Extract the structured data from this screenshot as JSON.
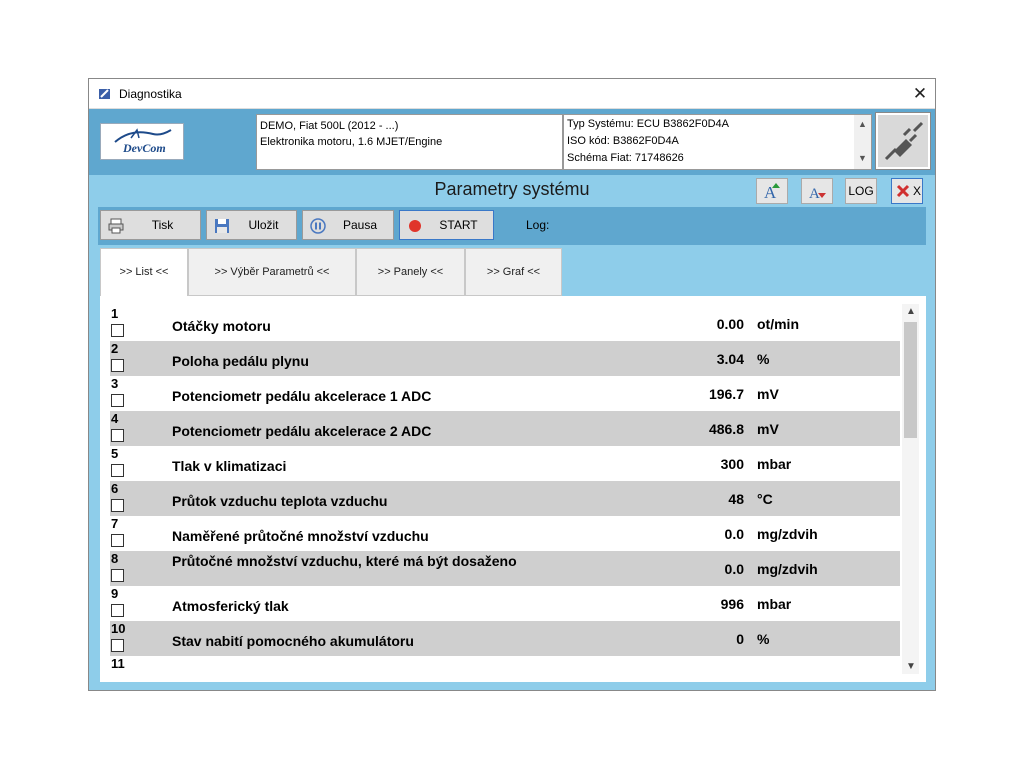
{
  "window": {
    "title": "Diagnostika",
    "close": "✕"
  },
  "logo": {
    "text": "DevCom"
  },
  "vehicle_info": {
    "line1": "DEMO, Fiat 500L (2012 - ...)",
    "line2": "Elektronika motoru, 1.6 MJET/Engine"
  },
  "system_info": {
    "line1": "Typ Systému: ECU B3862F0D4A",
    "line2": "ISO kód: B3862F0D4A",
    "line3": "Schéma Fiat: 71748626"
  },
  "heading": "Parametry systému",
  "top_buttons": {
    "log": "LOG",
    "close_x": "X"
  },
  "toolbar": {
    "print": "Tisk",
    "save": "Uložit",
    "pause": "Pausa",
    "start": "START",
    "log_label": "Log:"
  },
  "tabs": [
    ">> List <<",
    ">> Výběr Parametrů <<",
    ">> Panely <<",
    ">> Graf <<"
  ],
  "rows": [
    {
      "num": "1",
      "name": "Otáčky motoru",
      "value": "0.00",
      "unit": "ot/min"
    },
    {
      "num": "2",
      "name": "Poloha pedálu plynu",
      "value": "3.04",
      "unit": "%"
    },
    {
      "num": "3",
      "name": "Potenciometr pedálu akcelerace 1 ADC",
      "value": "196.7",
      "unit": "mV"
    },
    {
      "num": "4",
      "name": "Potenciometr pedálu akcelerace 2 ADC",
      "value": "486.8",
      "unit": "mV"
    },
    {
      "num": "5",
      "name": "Tlak v klimatizaci",
      "value": "300",
      "unit": "mbar"
    },
    {
      "num": "6",
      "name": "Průtok vzduchu teplota vzduchu",
      "value": "48",
      "unit": "°C"
    },
    {
      "num": "7",
      "name": "Naměřené průtočné množství vzduchu",
      "value": "0.0",
      "unit": "mg/zdvih"
    },
    {
      "num": "8",
      "name": "Průtočné množství vzduchu, které má být dosaženo",
      "value": "0.0",
      "unit": "mg/zdvih"
    },
    {
      "num": "9",
      "name": "Atmosferický tlak",
      "value": "996",
      "unit": "mbar"
    },
    {
      "num": "10",
      "name": "Stav nabití pomocného akumulátoru",
      "value": "0",
      "unit": "%"
    },
    {
      "num": "11",
      "name": "",
      "value": "",
      "unit": ""
    }
  ],
  "colors": {
    "window_bg": "#8ecdea",
    "header_bg": "#5fa7cf",
    "row_shade": "#cfcfcf"
  }
}
